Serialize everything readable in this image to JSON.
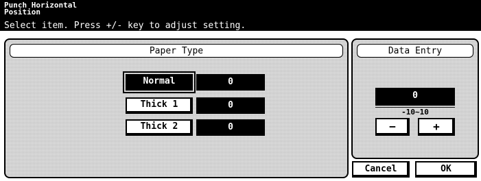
{
  "header": {
    "title": "Punch Horizontal\nPosition",
    "instruction": "Select item. Press +/- key to adjust setting."
  },
  "paper_type_panel": {
    "heading": "Paper Type",
    "items": [
      {
        "label": "Normal",
        "value": "0",
        "selected": true
      },
      {
        "label": "Thick 1",
        "value": "0",
        "selected": false
      },
      {
        "label": "Thick 2",
        "value": "0",
        "selected": false
      }
    ]
  },
  "data_entry_panel": {
    "heading": "Data Entry",
    "current_value": "0",
    "range": "-10~10",
    "minus_label": "−",
    "plus_label": "+"
  },
  "footer": {
    "cancel_label": "Cancel",
    "ok_label": "OK"
  }
}
